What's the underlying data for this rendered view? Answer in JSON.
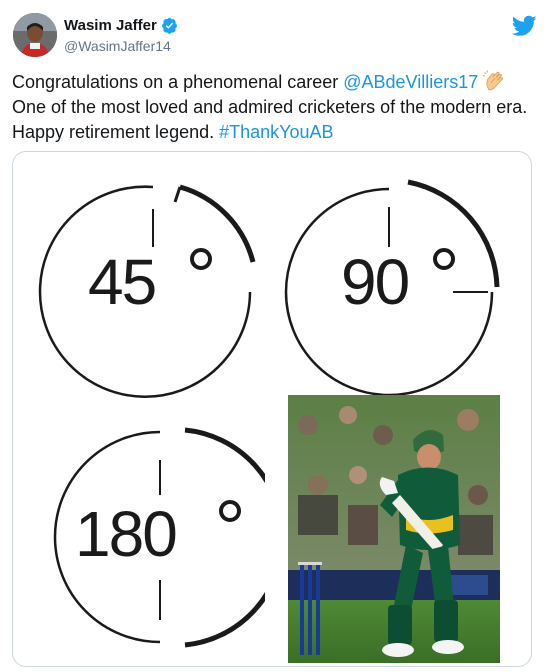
{
  "user": {
    "display_name": "Wasim Jaffer",
    "handle": "@WasimJaffer14",
    "verified": true
  },
  "tweet": {
    "text_part1": "Congratulations on a phenomenal career ",
    "mention": "@ABdeVilliers17",
    "text_part2": " One of the most loved and admired cricketers of the modern era. Happy retirement legend. ",
    "hashtag": "#ThankYouAB",
    "emoji": "clapping-hands"
  },
  "media": {
    "dials": [
      {
        "label": "45",
        "unit": "°"
      },
      {
        "label": "90",
        "unit": "°"
      },
      {
        "label": "180",
        "unit": "°"
      }
    ],
    "photo_description_icon": "cricket-batsman-photo"
  },
  "colors": {
    "link": "#1b95e0",
    "twitter_blue": "#1da1f2",
    "grass": "#3f7a2c",
    "jersey": "#0f5b3a"
  }
}
